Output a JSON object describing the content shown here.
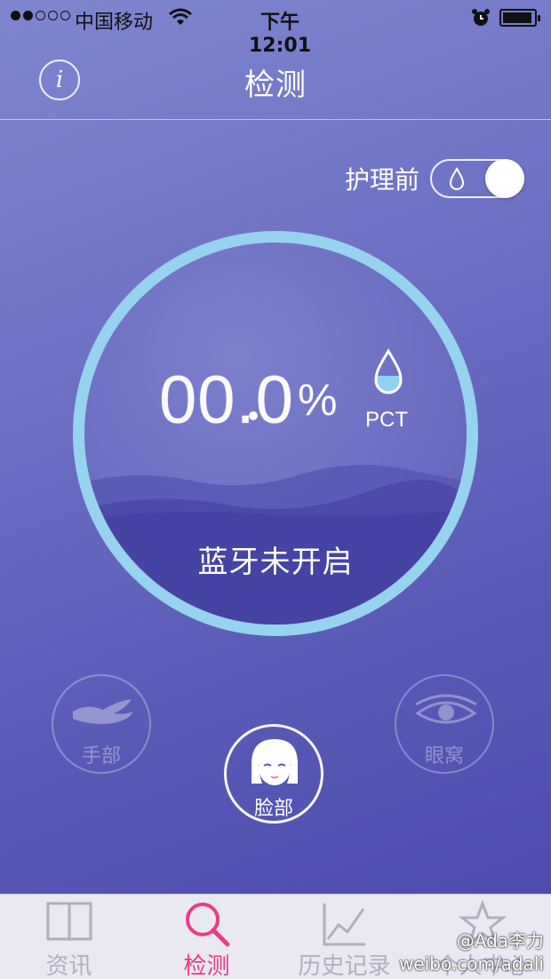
{
  "status_bar": {
    "carrier": "中国移动",
    "time": "下午12:01",
    "signal_bars_filled": 2,
    "signal_bars_total": 5,
    "wifi_icon": "wifi-icon",
    "alarm_icon": "alarm-clock-icon",
    "battery_icon": "battery-icon"
  },
  "nav": {
    "title": "检测",
    "info_label": "i",
    "info_icon": "info-icon"
  },
  "care_toggle": {
    "label": "护理前",
    "icon": "water-drop-icon",
    "on": true
  },
  "gauge": {
    "reading": "00.0",
    "unit": "%",
    "pct_label": "PCT",
    "pct_icon": "water-drop-icon",
    "bluetooth_status": "蓝牙未开启",
    "ring_color": "#95d3ef"
  },
  "body_parts": {
    "hand": {
      "label": "手部",
      "icon": "hand-icon",
      "active": false
    },
    "face": {
      "label": "脸部",
      "icon": "face-icon",
      "active": true
    },
    "eye": {
      "label": "眼窝",
      "icon": "eye-icon",
      "active": false
    }
  },
  "tab_bar": {
    "active_color": "#e83d85",
    "tabs": [
      {
        "label": "资讯",
        "icon": "book-icon",
        "active": false
      },
      {
        "label": "检测",
        "icon": "search-icon",
        "active": true
      },
      {
        "label": "历史记录",
        "icon": "line-chart-icon",
        "active": false
      },
      {
        "label": "个人中心",
        "icon": "star-icon",
        "active": false
      }
    ]
  },
  "watermark": {
    "line1": "@Ada李力",
    "line2": "weibo.com/adali"
  }
}
